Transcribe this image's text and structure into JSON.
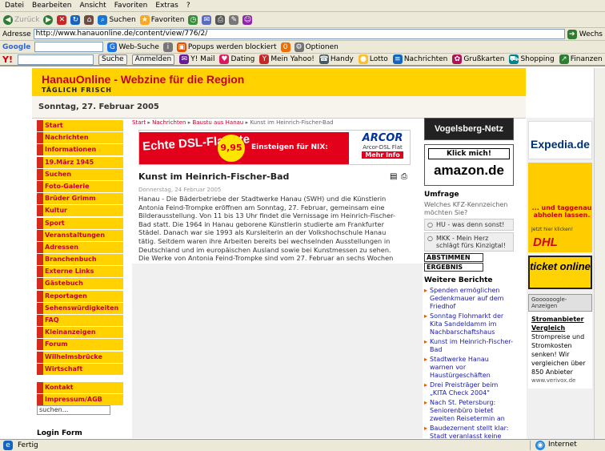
{
  "menu": [
    "Datei",
    "Bearbeiten",
    "Ansicht",
    "Favoriten",
    "Extras",
    "?"
  ],
  "toolbar": {
    "back": "Zurück",
    "search": "Suchen",
    "favorites": "Favoriten"
  },
  "address": {
    "label": "Adresse",
    "url": "http://www.hanauonline.de/content/view/776/2/",
    "go": "Wechs"
  },
  "googlebar": {
    "logo": "Google",
    "web_search": "Web-Suche",
    "popups": "Popups werden blockiert",
    "options": "Optionen"
  },
  "yahoobar": {
    "logo": "Y!",
    "search_btn": "Suche",
    "login": "Anmelden",
    "mail": "Y! Mail",
    "dating": "Dating",
    "myyahoo": "Mein Yahoo!",
    "handy": "Handy",
    "lotto": "Lotto",
    "news": "Nachrichten",
    "cards": "Grußkarten",
    "shopping": "Shopping",
    "finance": "Finanzen"
  },
  "header": {
    "title": "HanauOnline - Webzine für die Region",
    "subtitle": "TÄGLICH FRISCH"
  },
  "date": "Sonntag, 27. Februar 2005",
  "nav": [
    "Start",
    "Nachrichten",
    "Informationen",
    "19.März 1945",
    "Suchen",
    "Foto-Galerie",
    "Brüder Grimm",
    "Kultur",
    "Sport",
    "Veranstaltungen",
    "Adressen",
    "Branchenbuch",
    "Externe Links",
    "Gästebuch",
    "Reportagen",
    "Sehenswürdigkeiten",
    "FAQ",
    "Kleinanzeigen",
    "Forum",
    "Wilhelmsbrücke",
    "Wirtschaft"
  ],
  "nav2": [
    "Kontakt",
    "Impressum/AGB"
  ],
  "search_placeholder": "suchen...",
  "login_title": "Login Form",
  "breadcrumb": {
    "home": "Start",
    "c1": "Nachrichten",
    "c2": "Baustu aus Hanau",
    "current": "Kunst im Heinrich-Fischer-Bad"
  },
  "banner": {
    "headline": "Echte DSL-Flatrate",
    "price": "9,95",
    "cta": "Einsteigen für NIX:",
    "brand": "ARCOR",
    "product": "Arcor-DSL Flat",
    "more": "Mehr Info"
  },
  "article": {
    "title": "Kunst im Heinrich-Fischer-Bad",
    "date": "Donnerstag, 24 Februar 2005",
    "body": "Hanau - Die Bäderbetriebe der Stadtwerke Hanau (SWH) und die Künstlerin Antonia Feind-Trompke eröffnen am Sonntag, 27. Februar, gemeinsam eine Bilderausstellung. Von 11 bis 13 Uhr findet die Vernissage im Heinrich-Fischer-Bad statt. Die 1964 in Hanau geborene Künstlerin studierte am Frankfurter Städel. Danach war sie 1993 als Kursleiterin an der Volkshochschule Hanau tätig. Seitdem waren ihre Arbeiten bereits bei wechselnden Ausstellungen in Deutschland und im europäischen Ausland sowie bei Kunstmessen zu sehen. Die Werke von Antonia Feind-Trompke sind vom 27. Februar an sechs Wochen im Heinrich-Fischer-Bad zu sehen. (Presse SWHU)"
  },
  "col3": {
    "vog": "Vogelsberg-Netz",
    "amazon_click": "Klick mich!",
    "amazon": "amazon.de",
    "poll_title": "Umfrage",
    "poll_q": "Welches KFZ-Kennzeichen möchten Sie?",
    "poll_a1": "HU - was denn sonst!",
    "poll_a2": "MKK - Mein Herz schlägt fürs Kinzigtal!",
    "vote": "ABSTIMMEN",
    "result": "ERGEBNIS",
    "reports_title": "Weitere Berichte",
    "reports": [
      "Spenden ermöglichen Gedenkmauer auf dem Friedhof",
      "Sonntag Flohmarkt der Kita Sandeldamm im Nachbarschaftshaus",
      "Kunst im Heinrich-Fischer-Bad",
      "Stadtwerke Hanau warnen vor Haustürgeschäften",
      "Drei Preisträger beim „KITA Check 2004\"",
      "Nach St. Petersburg: Seniorenbüro bietet zweiten Reisetermin an",
      "Baudezernent stellt klar: Stadt veranlasst keine"
    ]
  },
  "col4": {
    "expedia": "Expedia.de",
    "dhl_text": "... und taggenau abholen lassen.",
    "dhl_sub": "Jetzt hier klicken!",
    "dhl": "DHL",
    "ticket": "ticket online",
    "google_ads": "Goooooogle-Anzeigen",
    "ad_title": "Stromanbieter Vergleich",
    "ad_text": "Strompreise und Stromkosten senken! Wir vergleichen über 850 Anbieter",
    "ad_url": "www.verivox.de"
  },
  "status": {
    "text": "Fertig",
    "zone": "Internet"
  },
  "colors": {
    "yellow": "#ffd200",
    "red": "#c4002a",
    "navborder": "#d42b1e"
  }
}
